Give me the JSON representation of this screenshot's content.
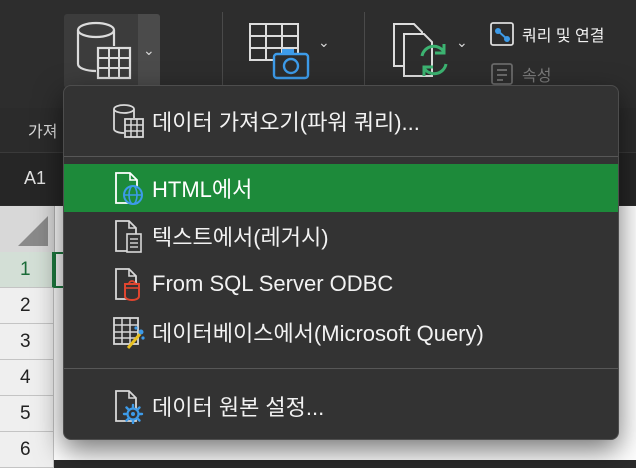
{
  "ribbon": {
    "group_label_partial": "가져",
    "query_connect_label": "쿼리 및 연결",
    "properties_label": "속성"
  },
  "formula_bar": {
    "cell_reference": "A1"
  },
  "grid": {
    "row_headers": [
      "1",
      "2",
      "3",
      "4",
      "5",
      "6"
    ]
  },
  "menu": {
    "items": [
      {
        "label": "데이터 가져오기(파워 쿼리)...",
        "icon": "database-table-icon"
      },
      {
        "label": "HTML에서",
        "icon": "html-globe-icon",
        "highlighted": true
      },
      {
        "label": "텍스트에서(레거시)",
        "icon": "text-file-icon"
      },
      {
        "label": "From SQL Server ODBC",
        "icon": "sql-server-odbc-icon"
      },
      {
        "label": "데이터베이스에서(Microsoft Query)",
        "icon": "microsoft-query-icon"
      },
      {
        "label": "데이터 원본 설정...",
        "icon": "data-source-settings-icon"
      }
    ]
  },
  "colors": {
    "accent_highlight": "#1d8a3a",
    "menu_background": "#333333",
    "ribbon_background": "#2d2d2d",
    "icon_blue": "#3d9be9",
    "icon_green": "#3cb371",
    "icon_red": "#e0452f"
  }
}
